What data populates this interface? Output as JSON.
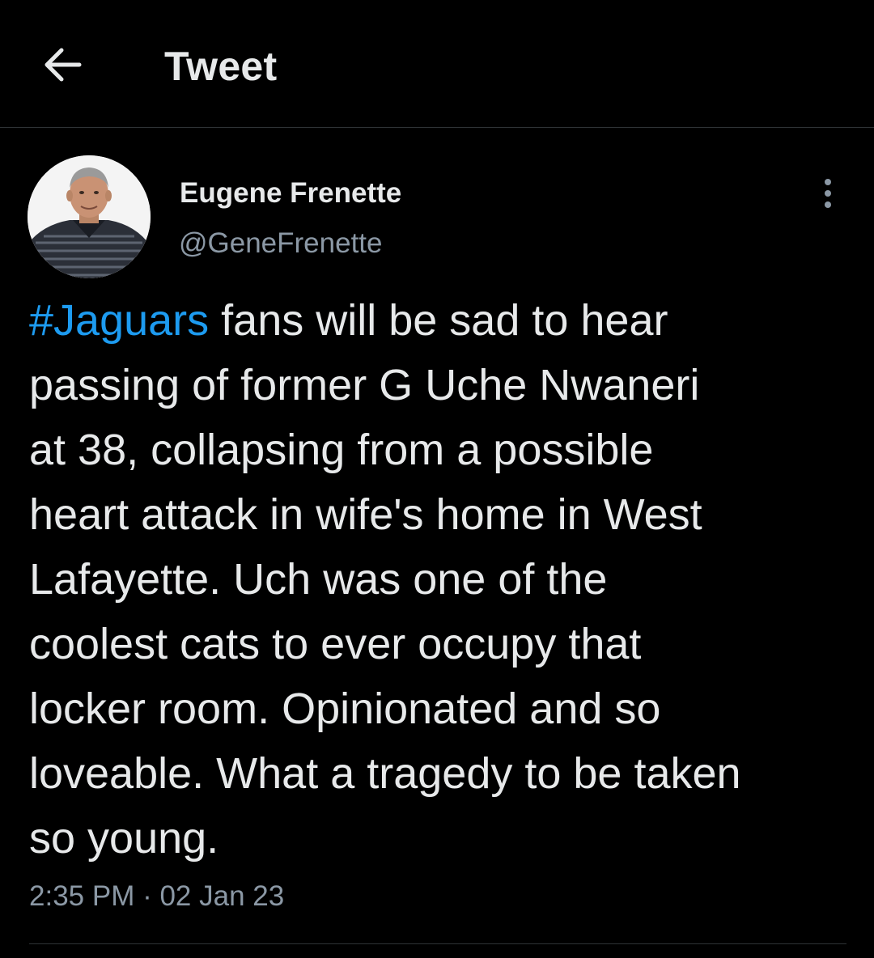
{
  "header": {
    "title": "Tweet",
    "back_icon": "arrow-left-icon"
  },
  "author": {
    "display_name": "Eugene Frenette",
    "handle": "@GeneFrenette",
    "more_icon": "more-vertical-icon"
  },
  "tweet": {
    "lines": [
      {
        "hashtag": "#Jaguars",
        "text": " fans will be sad to hear"
      },
      {
        "text": "passing of former G Uche Nwaneri"
      },
      {
        "text": "at 38, collapsing from a possible"
      },
      {
        "text": "heart attack in wife's home in West"
      },
      {
        "text": "Lafayette. Uch was one of the"
      },
      {
        "text": "coolest cats to ever occupy that"
      },
      {
        "text": "locker room. Opinionated and so"
      },
      {
        "text": "loveable. What a tragedy to be taken"
      },
      {
        "text": "so young."
      }
    ],
    "time": "2:35 PM",
    "separator": " · ",
    "date": "02 Jan 23"
  },
  "colors": {
    "background": "#000000",
    "text_primary": "#e7e9ea",
    "text_secondary": "#8b98a5",
    "accent": "#1d9bf0",
    "divider": "#2f3336"
  }
}
